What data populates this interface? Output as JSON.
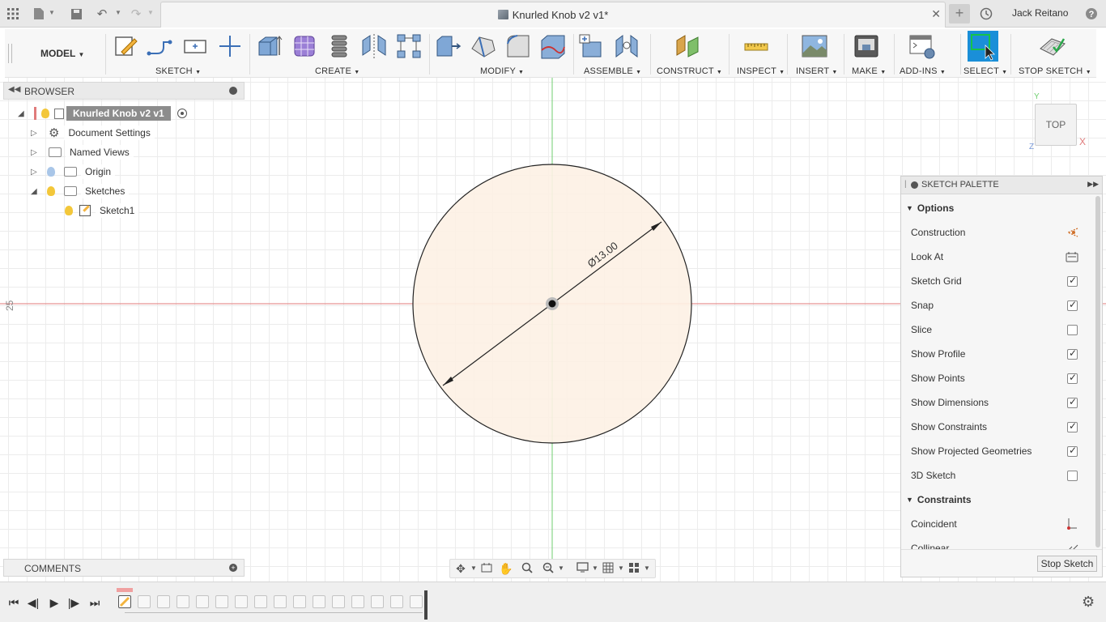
{
  "app": {
    "document_title": "Knurled Knob v2 v1*",
    "user_name": "Jack Reitano",
    "workspace": "MODEL"
  },
  "toolbar": {
    "groups": [
      {
        "label": "SKETCH"
      },
      {
        "label": "CREATE"
      },
      {
        "label": "MODIFY"
      },
      {
        "label": "ASSEMBLE"
      },
      {
        "label": "CONSTRUCT"
      },
      {
        "label": "INSPECT"
      },
      {
        "label": "INSERT"
      },
      {
        "label": "MAKE"
      },
      {
        "label": "ADD-INS"
      },
      {
        "label": "SELECT"
      },
      {
        "label": "STOP SKETCH"
      }
    ]
  },
  "browser": {
    "title": "BROWSER",
    "root": "Knurled Knob v2 v1",
    "items": [
      {
        "label": "Document Settings"
      },
      {
        "label": "Named Views"
      },
      {
        "label": "Origin"
      },
      {
        "label": "Sketches"
      },
      {
        "label": "Sketch1"
      }
    ]
  },
  "comments": {
    "title": "COMMENTS"
  },
  "viewport": {
    "dimension_text": "Ø13.00",
    "ruler_label": "25",
    "viewcube_face": "TOP",
    "axis_y": "Y",
    "axis_x": "X",
    "axis_z": "Z",
    "colors": {
      "profile_fill": "#fdf1e4",
      "x_axis": "#e07b7b",
      "y_axis": "#6fce6f"
    }
  },
  "palette": {
    "title": "SKETCH PALETTE",
    "options_header": "Options",
    "options": [
      {
        "label": "Construction",
        "type": "icon",
        "icon": "construction-icon"
      },
      {
        "label": "Look At",
        "type": "icon",
        "icon": "look-at-icon"
      },
      {
        "label": "Sketch Grid",
        "type": "checkbox",
        "checked": true
      },
      {
        "label": "Snap",
        "type": "checkbox",
        "checked": true
      },
      {
        "label": "Slice",
        "type": "checkbox",
        "checked": false
      },
      {
        "label": "Show Profile",
        "type": "checkbox",
        "checked": true
      },
      {
        "label": "Show Points",
        "type": "checkbox",
        "checked": true
      },
      {
        "label": "Show Dimensions",
        "type": "checkbox",
        "checked": true
      },
      {
        "label": "Show Constraints",
        "type": "checkbox",
        "checked": true
      },
      {
        "label": "Show Projected Geometries",
        "type": "checkbox",
        "checked": true
      },
      {
        "label": "3D Sketch",
        "type": "checkbox",
        "checked": false
      }
    ],
    "constraints_header": "Constraints",
    "constraints": [
      {
        "label": "Coincident",
        "icon": "coincident-icon"
      },
      {
        "label": "Collinear",
        "icon": "collinear-icon"
      }
    ],
    "stop_button": "Stop Sketch"
  }
}
